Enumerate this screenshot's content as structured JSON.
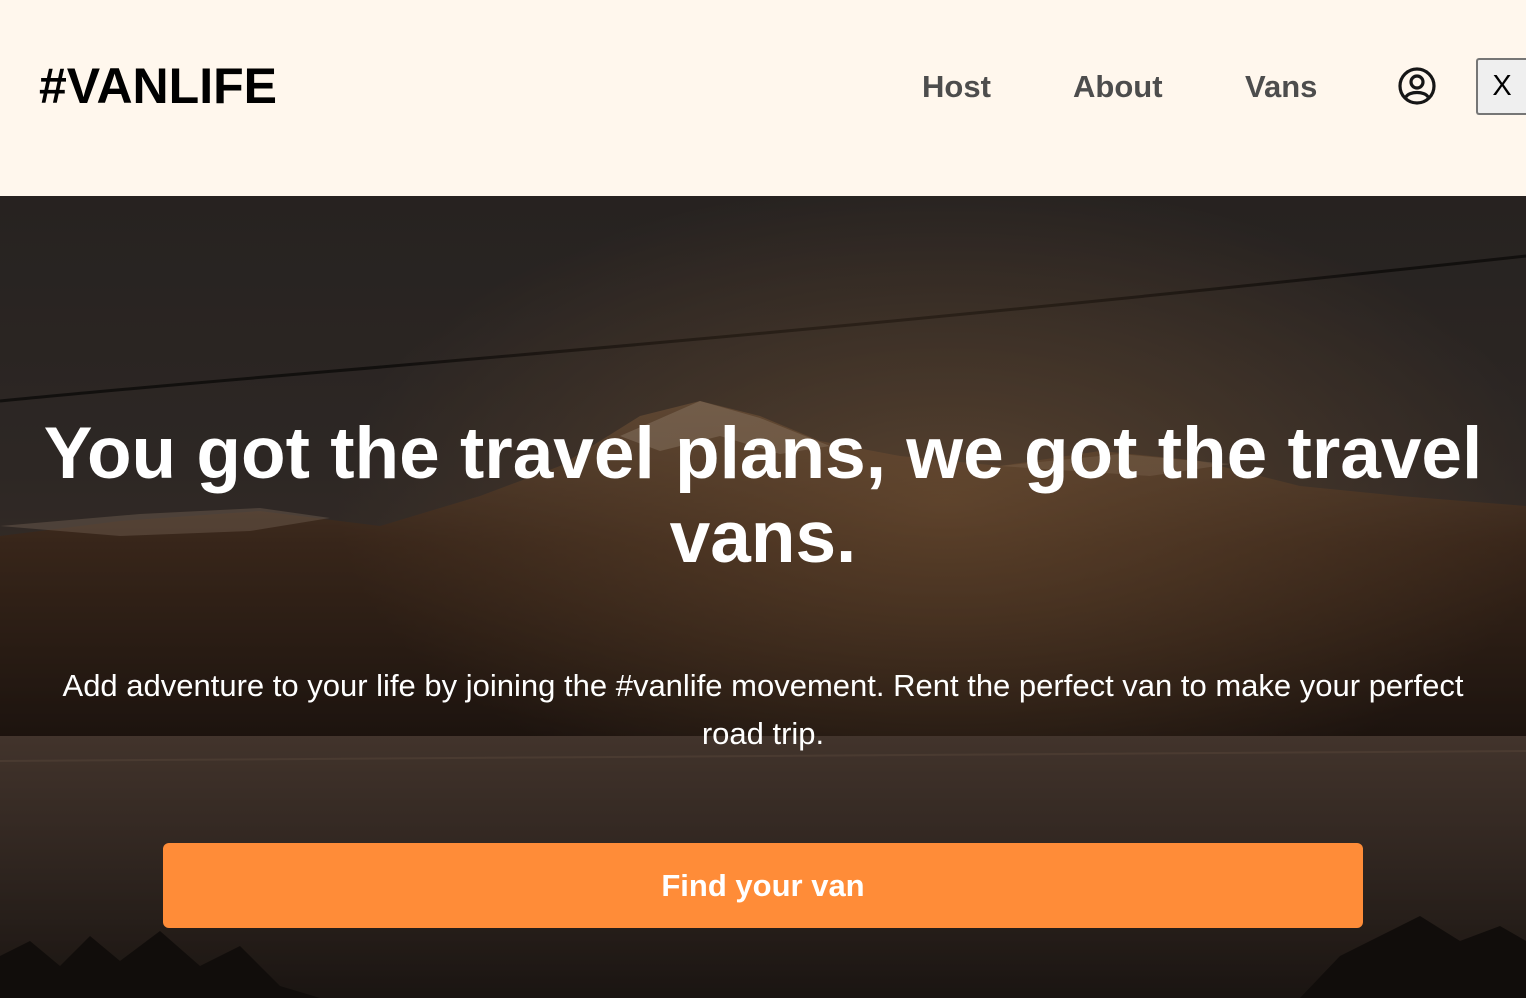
{
  "header": {
    "logo": "#VANLIFE",
    "nav": [
      {
        "label": "Host"
      },
      {
        "label": "About"
      },
      {
        "label": "Vans"
      }
    ],
    "user_icon": "user-circle-icon",
    "close_label": "X"
  },
  "hero": {
    "title": "You got the travel plans, we got the travel vans.",
    "text": "Add adventure to your life by joining the #vanlife movement. Rent the perfect van to make your perfect road trip.",
    "cta_label": "Find your van",
    "background": "mountain-lake-photo"
  },
  "colors": {
    "header_bg": "#FFF7ED",
    "nav_text": "#4D4D4D",
    "accent": "#FF8C38"
  }
}
